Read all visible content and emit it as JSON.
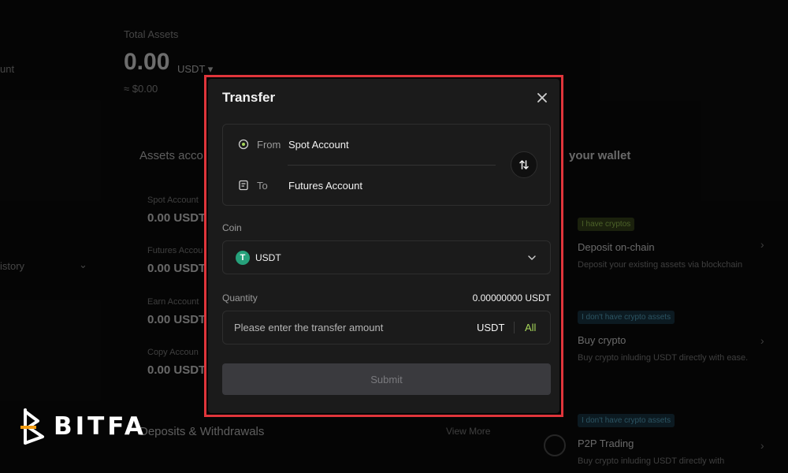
{
  "background": {
    "total_assets_label": "Total Assets",
    "total_assets_value": "0.00",
    "total_assets_unit": "USDT ▾",
    "total_assets_usd": "≈ $0.00",
    "left_partial_1": "unt",
    "left_partial_2": "istory",
    "assets_title": "Assets acco",
    "accounts": [
      {
        "label": "Spot Account",
        "value": "0.00 USDT"
      },
      {
        "label": "Futures Accou",
        "value": "0.00 USDT"
      },
      {
        "label": "Earn Account",
        "value": "0.00 USDT"
      },
      {
        "label": "Copy Accoun",
        "value": "0.00 USDT"
      }
    ],
    "deposits_title": "Deposits & Withdrawals",
    "view_more": "View More",
    "wallet_title": "your wallet",
    "wallet_cards": [
      {
        "badge": "I have cryptos",
        "title": "Deposit on-chain",
        "desc": "Deposit your existing assets via blockchain"
      },
      {
        "badge": "I don't have crypto assets",
        "title": "Buy crypto",
        "desc": "Buy crypto inluding USDT directly with ease."
      },
      {
        "badge": "I don't have crypto assets",
        "title": "P2P Trading",
        "desc": "Buy crypto inluding USDT directly with"
      }
    ]
  },
  "logo": {
    "text": "BITFA"
  },
  "modal": {
    "title": "Transfer",
    "from_label": "From",
    "from_value": "Spot Account",
    "to_label": "To",
    "to_value": "Futures Account",
    "coin_label": "Coin",
    "coin_value": "USDT",
    "coin_icon_glyph": "T",
    "quantity_label": "Quantity",
    "quantity_balance": "0.00000000 USDT",
    "amount_placeholder": "Please enter the transfer amount",
    "amount_unit": "USDT",
    "all_label": "All",
    "submit_label": "Submit"
  },
  "colors": {
    "highlight_frame": "#e0353b",
    "accent_green": "#a6d65a",
    "usdt_green": "#26a17b"
  }
}
